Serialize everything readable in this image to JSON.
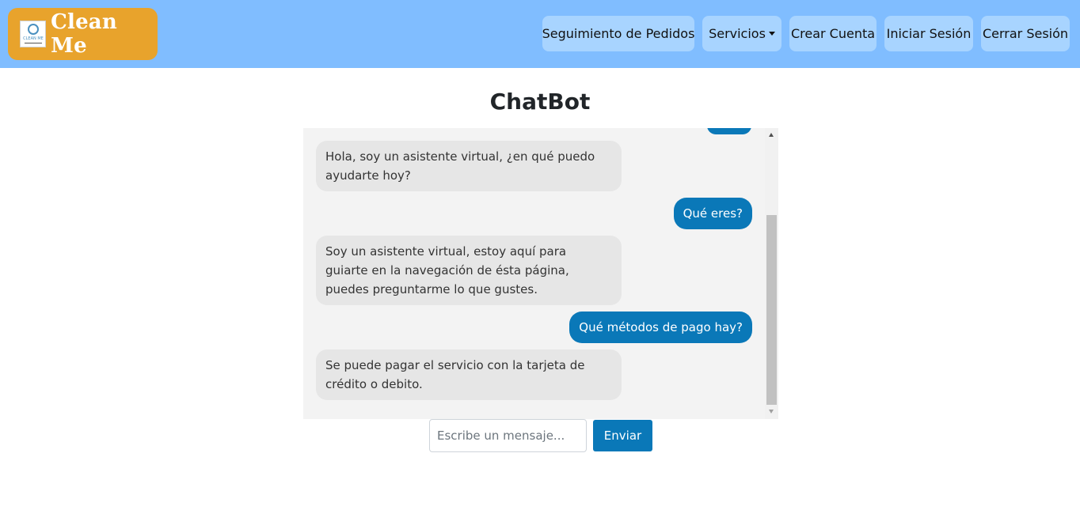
{
  "brand": {
    "name": "Clean Me",
    "logo_text": "CLEAN ME"
  },
  "nav": {
    "tracking": "Seguimiento de Pedidos",
    "services": "Servicios",
    "create_account": "Crear Cuenta",
    "login": "Iniciar Sesión",
    "logout": "Cerrar Sesión"
  },
  "chat": {
    "title": "ChatBot",
    "messages": [
      {
        "from": "bot",
        "text": "Hola, soy un asistente virtual, ¿en qué puedo ayudarte hoy?"
      },
      {
        "from": "user",
        "text": "Qué eres?"
      },
      {
        "from": "bot",
        "text": "Soy un asistente virtual, estoy aquí para guiarte en la navegación de ésta página, puedes preguntarme lo que gustes."
      },
      {
        "from": "user",
        "text": "Qué métodos de pago hay?"
      },
      {
        "from": "bot",
        "text": "Se puede pagar el servicio con la tarjeta de crédito o debito."
      }
    ],
    "input": {
      "value": "",
      "placeholder": "Escribe un mensaje..."
    },
    "send_label": "Enviar"
  },
  "colors": {
    "navbar": "#80bdff",
    "brand_bg": "#e8a32c",
    "nav_button": "#a8d4ff",
    "user_bubble": "#0a78b8",
    "bot_bubble": "#e6e6e6",
    "chat_bg": "#f3f3f3"
  }
}
